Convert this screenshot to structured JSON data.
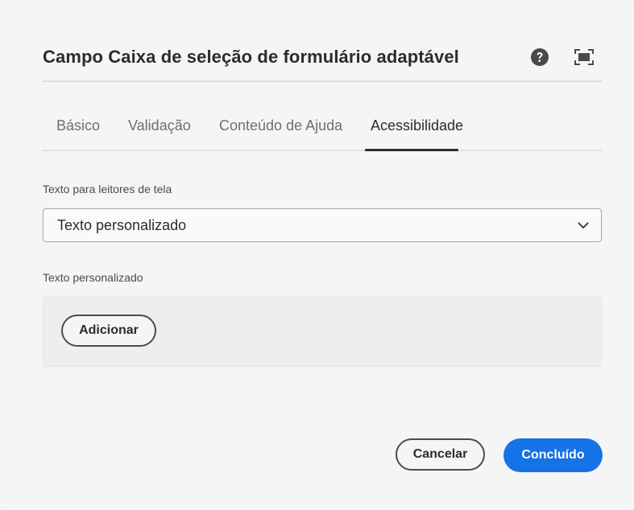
{
  "dialog": {
    "title": "Campo Caixa de seleção de formulário adaptável",
    "header_icons": {
      "help": "help-circle-icon",
      "fullscreen": "fullscreen-icon"
    }
  },
  "tabs": [
    {
      "label": "Básico",
      "selected": false
    },
    {
      "label": "Validação",
      "selected": false
    },
    {
      "label": "Conteúdo de Ajuda",
      "selected": false
    },
    {
      "label": "Acessibilidade",
      "selected": true
    }
  ],
  "screen_reader": {
    "label": "Texto para leitores de tela",
    "selected_value": "Texto personalizado",
    "icon": "chevron-down-icon"
  },
  "custom_text": {
    "label": "Texto personalizado",
    "add_button": "Adicionar"
  },
  "footer": {
    "cancel": "Cancelar",
    "done": "Concluído"
  },
  "colors": {
    "accent": "#1473e6",
    "background": "#f5f5f5",
    "text": "#2c2c2c"
  }
}
